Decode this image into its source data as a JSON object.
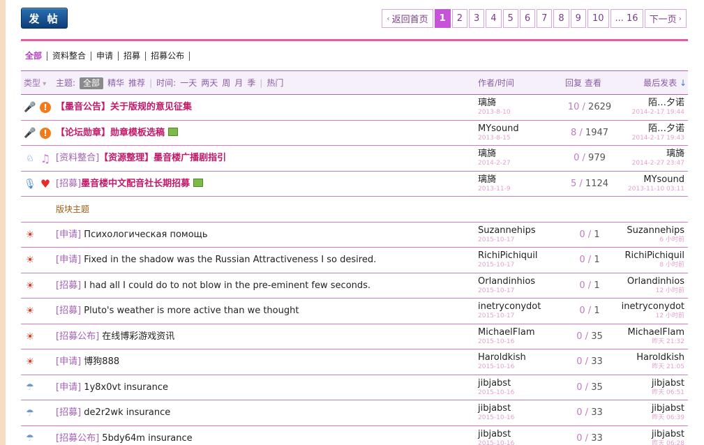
{
  "toolbar": {
    "post_label": "发 帖"
  },
  "pager": {
    "first_label": "返回首页",
    "pages": [
      "1",
      "2",
      "3",
      "4",
      "5",
      "6",
      "7",
      "8",
      "9",
      "10"
    ],
    "current": "1",
    "last_label": "... 16",
    "next_label": "下一页"
  },
  "cats": [
    "全部",
    "资料整合",
    "申请",
    "招募",
    "招募公布"
  ],
  "thead": {
    "type": "类型",
    "subject": "主题:",
    "all": "全部",
    "digest": "精华",
    "recommend": "推荐",
    "time": "时间:",
    "t1": "一天",
    "t2": "两天",
    "t3": "周",
    "t4": "月",
    "t5": "季",
    "hot": "热门",
    "author": "作者/时间",
    "replies": "回复 查看",
    "last": "最后发表"
  },
  "section_label": "版块主题",
  "colors": {
    "accent": "#c654d9",
    "rule": "#e55aa8",
    "hot": "#c01a6a"
  },
  "pinned": [
    {
      "icon1": "mic-icon",
      "icon2": "warn-icon",
      "prefix": "",
      "title": "【墨音公告】关于版规的意见征集",
      "img": false,
      "author": "璃旖",
      "date": "2013-8-10",
      "replies": "10",
      "views": "2629",
      "last_user": "陌…夕诺",
      "last_time": "2014-2-17 19:44"
    },
    {
      "icon1": "mic-icon",
      "icon2": "warn-icon",
      "prefix": "",
      "title": "【论坛勋章】勋章模板选稿",
      "img": true,
      "author": "MYsound",
      "date": "2013-8-15",
      "replies": "8",
      "views": "1947",
      "last_user": "陌…夕诺",
      "last_time": "2014-2-17 19:43"
    },
    {
      "icon1": "dog-icon",
      "icon2": "note-icon",
      "prefix": "[资料整合]",
      "title": "【资源整理】墨音楼广播剧指引",
      "img": false,
      "author": "璃旖",
      "date": "2014-2-27",
      "replies": "0",
      "views": "979",
      "last_user": "璃旖",
      "last_time": "2014-2-27 23:47"
    },
    {
      "icon1": "mic2-icon",
      "icon2": "heart-icon",
      "prefix": "[招募]",
      "title": "墨音楼中文配音社长期招募",
      "img": true,
      "author": "璃旖",
      "date": "2013-11-9",
      "replies": "5",
      "views": "1124",
      "last_user": "MYsound",
      "last_time": "2013-11-10 03:11"
    }
  ],
  "threads": [
    {
      "icon": "sun",
      "prefix": "[申请]",
      "title": "Психологическая помощь",
      "author": "Suzannehips",
      "date": "2015-10-17",
      "replies": "0",
      "views": "1",
      "last_user": "Suzannehips",
      "last_time": "6 小时前"
    },
    {
      "icon": "sun",
      "prefix": "[申请]",
      "title": "Fixed in the shadow was the Russian Attractiveness I so desired.",
      "author": "RichiPichiquil",
      "date": "2015-10-17",
      "replies": "0",
      "views": "1",
      "last_user": "RichiPichiquil",
      "last_time": "8 小时前"
    },
    {
      "icon": "sun",
      "prefix": "[招募]",
      "title": "I had all I could do to not blow in the pre-eminent few seconds.",
      "author": "Orlandinhios",
      "date": "2015-10-17",
      "replies": "0",
      "views": "1",
      "last_user": "Orlandinhios",
      "last_time": "12 小时前"
    },
    {
      "icon": "sun",
      "prefix": "[招募]",
      "title": "Pluto's weather is more active than we thought",
      "author": "inetryconydot",
      "date": "2015-10-17",
      "replies": "0",
      "views": "1",
      "last_user": "inetryconydot",
      "last_time": "12 小时前"
    },
    {
      "icon": "sun",
      "prefix": "[招募公布]",
      "title": "在线博彩游戏资讯",
      "author": "MichaelFlam",
      "date": "2015-10-16",
      "replies": "0",
      "views": "35",
      "last_user": "MichaelFlam",
      "last_time": "昨天 21:32"
    },
    {
      "icon": "sun",
      "prefix": "[申请]",
      "title": "博狗888",
      "author": "Haroldkish",
      "date": "2015-10-16",
      "replies": "0",
      "views": "33",
      "last_user": "Haroldkish",
      "last_time": "昨天 21:05"
    },
    {
      "icon": "rain",
      "prefix": "[申请]",
      "title": "1y8x0vt insurance",
      "author": "jibjabst",
      "date": "2015-10-16",
      "replies": "0",
      "views": "35",
      "last_user": "jibjabst",
      "last_time": "昨天 06:51"
    },
    {
      "icon": "rain",
      "prefix": "[招募]",
      "title": "de2r2wk insurance",
      "author": "jibjabst",
      "date": "2015-10-16",
      "replies": "0",
      "views": "33",
      "last_user": "jibjabst",
      "last_time": "昨天 06:39"
    },
    {
      "icon": "rain",
      "prefix": "[招募公布]",
      "title": "5bdy64m insurance",
      "author": "jibjabst",
      "date": "2015-10-16",
      "replies": "0",
      "views": "33",
      "last_user": "jibjabst",
      "last_time": "昨天 06:28"
    }
  ]
}
